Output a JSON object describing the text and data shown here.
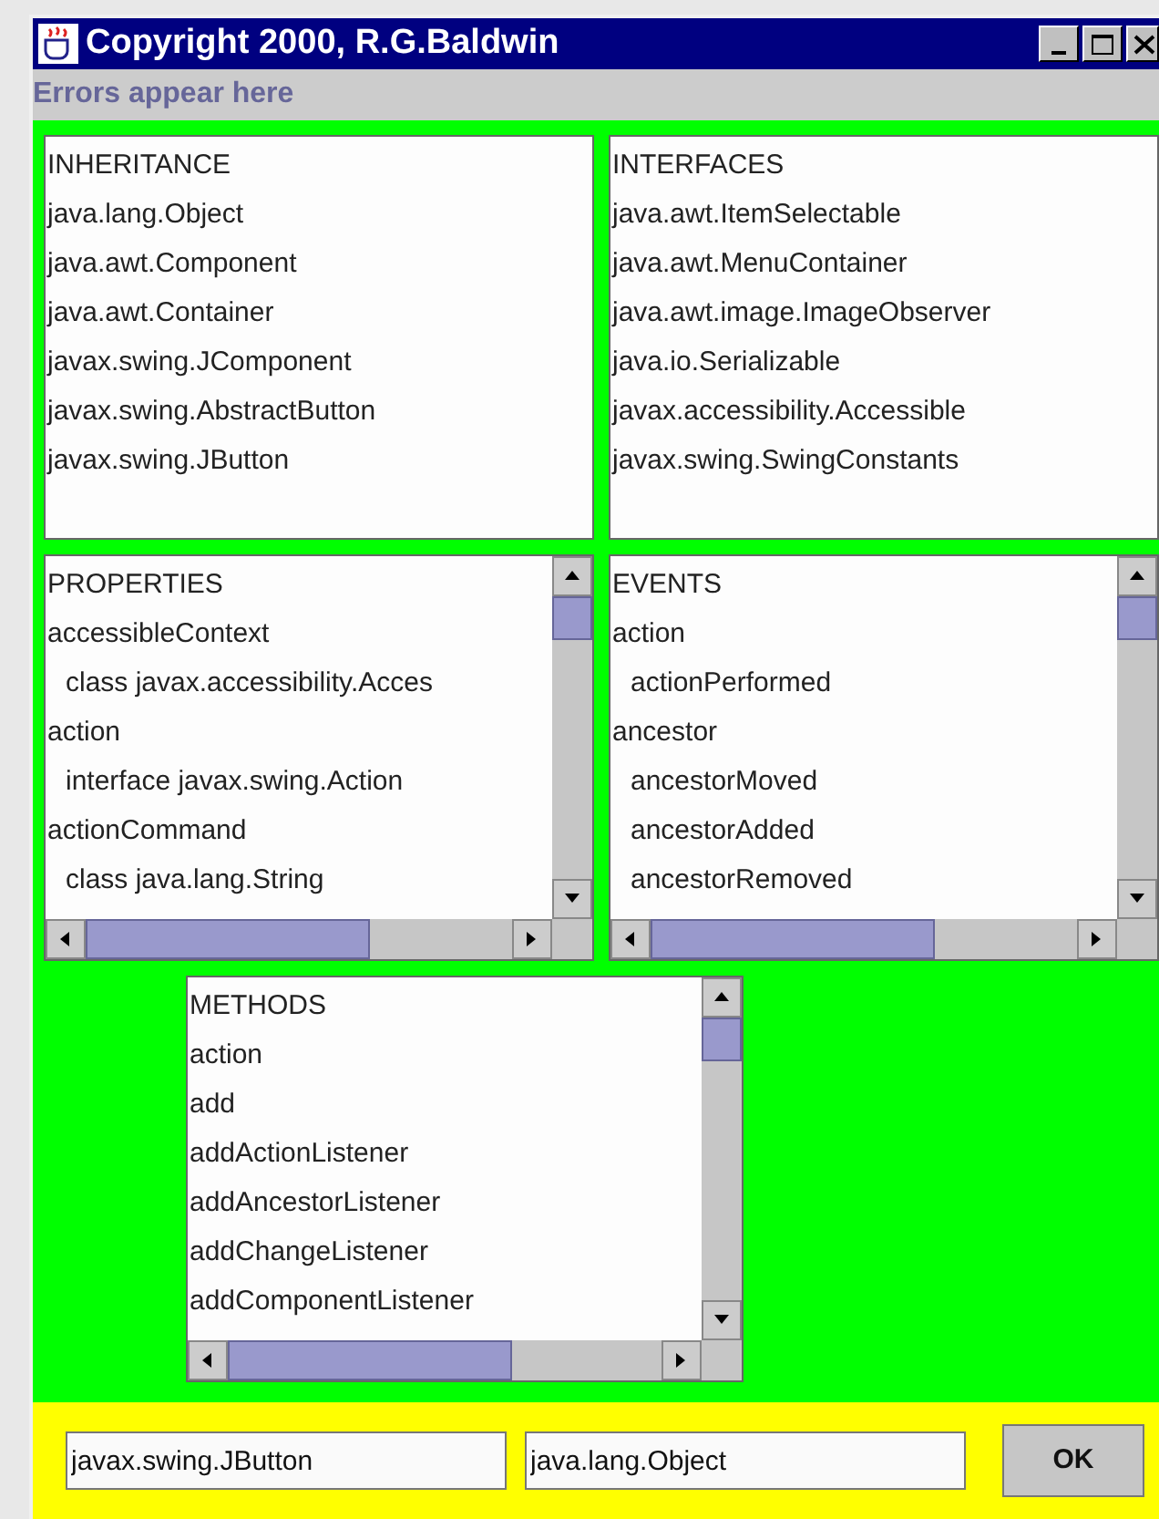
{
  "window": {
    "title": "Copyright 2000, R.G.Baldwin"
  },
  "error_label": "Errors appear here",
  "panels": [
    {
      "kind": "plain",
      "heading": "INHERITANCE",
      "items": [
        {
          "name": "java.lang.Object"
        },
        {
          "name": "java.awt.Component"
        },
        {
          "name": "java.awt.Container"
        },
        {
          "name": "javax.swing.JComponent"
        },
        {
          "name": "javax.swing.AbstractButton"
        },
        {
          "name": "javax.swing.JButton"
        }
      ]
    },
    {
      "kind": "plain",
      "heading": "INTERFACES",
      "items": [
        {
          "name": "java.awt.ItemSelectable"
        },
        {
          "name": "java.awt.MenuContainer"
        },
        {
          "name": "java.awt.image.ImageObserver"
        },
        {
          "name": "java.io.Serializable"
        },
        {
          "name": "javax.accessibility.Accessible"
        },
        {
          "name": "javax.swing.SwingConstants"
        }
      ]
    },
    {
      "kind": "scroll",
      "heading": "PROPERTIES",
      "items": [
        {
          "name": "accessibleContext",
          "children": [
            {
              "name": "class javax.accessibility.Acces"
            }
          ]
        },
        {
          "name": "action",
          "children": [
            {
              "name": "interface javax.swing.Action"
            }
          ]
        },
        {
          "name": "actionCommand",
          "children": [
            {
              "name": "class java.lang.String"
            }
          ]
        }
      ]
    },
    {
      "kind": "scroll",
      "heading": "EVENTS",
      "items": [
        {
          "name": "action",
          "children": [
            {
              "name": "actionPerformed"
            }
          ]
        },
        {
          "name": "ancestor",
          "children": [
            {
              "name": "ancestorMoved"
            },
            {
              "name": "ancestorAdded"
            },
            {
              "name": "ancestorRemoved"
            }
          ]
        }
      ]
    },
    {
      "kind": "scroll",
      "heading": "METHODS",
      "items": [
        {
          "name": "action"
        },
        {
          "name": "add"
        },
        {
          "name": "addActionListener"
        },
        {
          "name": "addAncestorListener"
        },
        {
          "name": "addChangeListener"
        },
        {
          "name": "addComponentListener"
        }
      ]
    }
  ],
  "fields": [
    {
      "value": "javax.swing.JButton"
    },
    {
      "value": "java.lang.Object"
    }
  ],
  "ok_button": "OK"
}
